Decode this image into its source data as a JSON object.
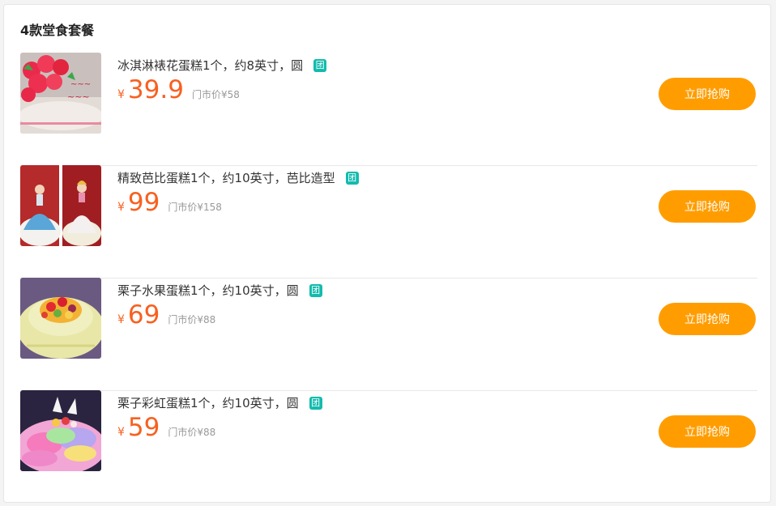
{
  "section_title": "4款堂食套餐",
  "badge_text": "团",
  "currency": "¥",
  "market_prefix": "门市价",
  "buy_label": "立即抢购",
  "colors": {
    "price": "#f76120",
    "buy_button": "#ff9d00",
    "badge": "#13bbae"
  },
  "items": [
    {
      "name": "冰淇淋裱花蛋糕1个，约8英寸，圆",
      "price": "39.9",
      "market_price": "¥58",
      "thumb_icon": "rose-cake-photo"
    },
    {
      "name": "精致芭比蛋糕1个，约10英寸，芭比造型",
      "price": "99",
      "market_price": "¥158",
      "thumb_icon": "barbie-cake-photo"
    },
    {
      "name": "栗子水果蛋糕1个，约10英寸，圆",
      "price": "69",
      "market_price": "¥88",
      "thumb_icon": "fruit-cake-photo"
    },
    {
      "name": "栗子彩虹蛋糕1个，约10英寸，圆",
      "price": "59",
      "market_price": "¥88",
      "thumb_icon": "rainbow-cake-photo"
    }
  ]
}
